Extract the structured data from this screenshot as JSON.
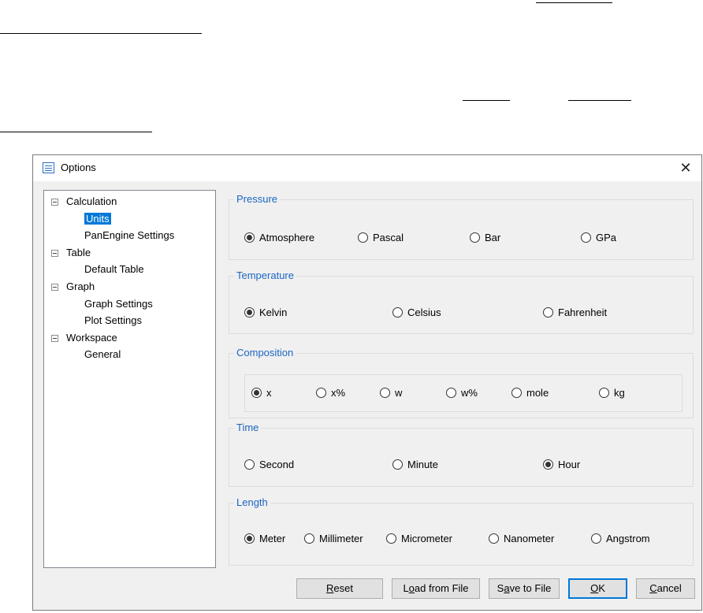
{
  "dialog": {
    "title": "Options",
    "close_glyph": "✕",
    "icon": "options-list-icon"
  },
  "tree": {
    "expander_icon": "tree-collapse-icon",
    "items": [
      {
        "label": "Calculation",
        "level": 0,
        "expander": true
      },
      {
        "label": "Units",
        "level": 1,
        "selected": true
      },
      {
        "label": "PanEngine Settings",
        "level": 1
      },
      {
        "label": "Table",
        "level": 0,
        "expander": true
      },
      {
        "label": "Default Table",
        "level": 1
      },
      {
        "label": "Graph",
        "level": 0,
        "expander": true
      },
      {
        "label": "Graph Settings",
        "level": 1
      },
      {
        "label": "Plot Settings",
        "level": 1
      },
      {
        "label": "Workspace",
        "level": 0,
        "expander": true
      },
      {
        "label": "General",
        "level": 1
      }
    ]
  },
  "groups": {
    "pressure": {
      "title": "Pressure",
      "options": [
        {
          "label": "Atmosphere",
          "checked": true
        },
        {
          "label": "Pascal",
          "checked": false
        },
        {
          "label": "Bar",
          "checked": false
        },
        {
          "label": "GPa",
          "checked": false
        }
      ]
    },
    "temperature": {
      "title": "Temperature",
      "options": [
        {
          "label": "Kelvin",
          "checked": true
        },
        {
          "label": "Celsius",
          "checked": false
        },
        {
          "label": "Fahrenheit",
          "checked": false
        }
      ]
    },
    "composition": {
      "title": "Composition",
      "options": [
        {
          "label": "x",
          "checked": true
        },
        {
          "label": "x%",
          "checked": false
        },
        {
          "label": "w",
          "checked": false
        },
        {
          "label": "w%",
          "checked": false
        },
        {
          "label": "mole",
          "checked": false
        },
        {
          "label": "kg",
          "checked": false
        }
      ]
    },
    "time": {
      "title": "Time",
      "options": [
        {
          "label": "Second",
          "checked": false
        },
        {
          "label": "Minute",
          "checked": false
        },
        {
          "label": "Hour",
          "checked": true
        }
      ]
    },
    "length": {
      "title": "Length",
      "options": [
        {
          "label": "Meter",
          "checked": true
        },
        {
          "label": "Millimeter",
          "checked": false
        },
        {
          "label": "Micrometer",
          "checked": false
        },
        {
          "label": "Nanometer",
          "checked": false
        },
        {
          "label": "Angstrom",
          "checked": false
        }
      ]
    }
  },
  "buttons": {
    "reset": {
      "label": "Reset",
      "mnemonic": "R"
    },
    "load": {
      "label": "Load from File",
      "mnemonic": "o"
    },
    "save": {
      "label": "Save to File",
      "mnemonic": "a"
    },
    "ok": {
      "label": "OK",
      "mnemonic": "O"
    },
    "cancel": {
      "label": "Cancel",
      "mnemonic": "C"
    }
  }
}
